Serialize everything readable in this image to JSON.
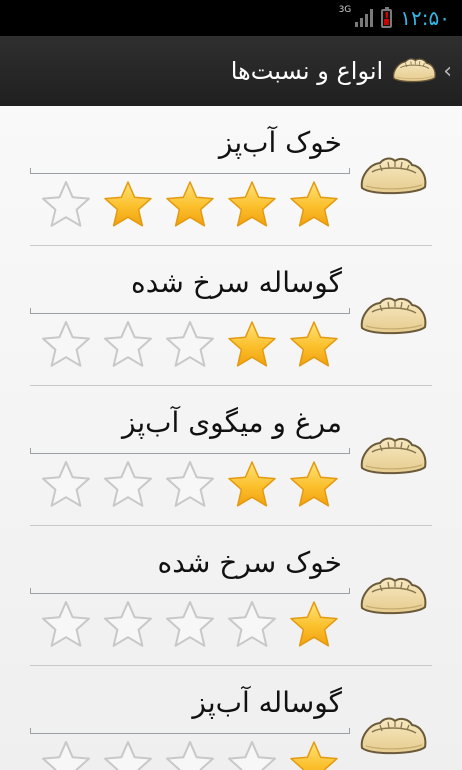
{
  "status_bar": {
    "network": "3G",
    "time": "۱۲:۵۰",
    "battery_alert": "!"
  },
  "action_bar": {
    "back_glyph": "‹",
    "title": "انواع و نسبت‌ها",
    "icon": "dumpling-icon"
  },
  "items": [
    {
      "title": "خوک آب‌پز",
      "rating": 4,
      "max": 5,
      "icon": "dumpling-icon"
    },
    {
      "title": "گوساله سرخ شده",
      "rating": 2,
      "max": 5,
      "icon": "dumpling-icon"
    },
    {
      "title": "مرغ و میگوی آب‌پز",
      "rating": 2,
      "max": 5,
      "icon": "dumpling-icon"
    },
    {
      "title": "خوک سرخ شده",
      "rating": 1,
      "max": 5,
      "icon": "dumpling-icon"
    },
    {
      "title": "گوساله آب‌پز",
      "rating": 1,
      "max": 5,
      "icon": "dumpling-icon"
    }
  ],
  "colors": {
    "star_filled": "#fbc02d",
    "star_empty_stroke": "#c8c8c8",
    "time": "#33b5e5",
    "dumpling": "#f1deb0"
  }
}
